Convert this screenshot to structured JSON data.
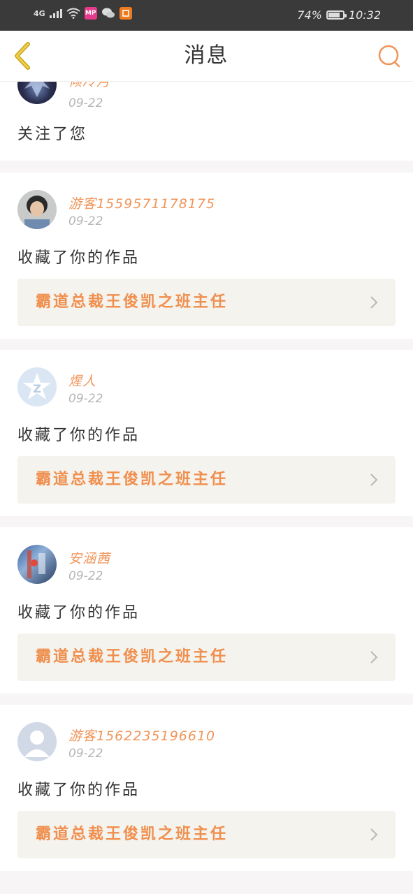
{
  "status_bar": {
    "network": "4G",
    "battery_percent": "74%",
    "battery_level": 0.74,
    "time": "10:32",
    "app_icons": [
      "MP",
      "wechat-icon",
      "app-icon"
    ]
  },
  "header": {
    "title": "消息",
    "back_icon": "chevron-left-icon",
    "search_icon": "search-icon"
  },
  "colors": {
    "accent": "#f0955a",
    "header_bg": "#ffffff",
    "statusbar_bg": "#3a3a3a",
    "work_bg": "#f4f3ee",
    "back_icon_color": "#d6b21c"
  },
  "messages": [
    {
      "user": "倾冷月",
      "date": "09-22",
      "action": "关注了您"
    },
    {
      "user": "游客1559571178175",
      "date": "09-22",
      "action": "收藏了你的作品",
      "work": "霸道总裁王俊凯之班主任"
    },
    {
      "user": "煋人",
      "date": "09-22",
      "action": "收藏了你的作品",
      "work": "霸道总裁王俊凯之班主任"
    },
    {
      "user": "安涵茜",
      "date": "09-22",
      "action": "收藏了你的作品",
      "work": "霸道总裁王俊凯之班主任"
    },
    {
      "user": "游客1562235196610",
      "date": "09-22",
      "action": "收藏了你的作品",
      "work": "霸道总裁王俊凯之班主任"
    }
  ]
}
